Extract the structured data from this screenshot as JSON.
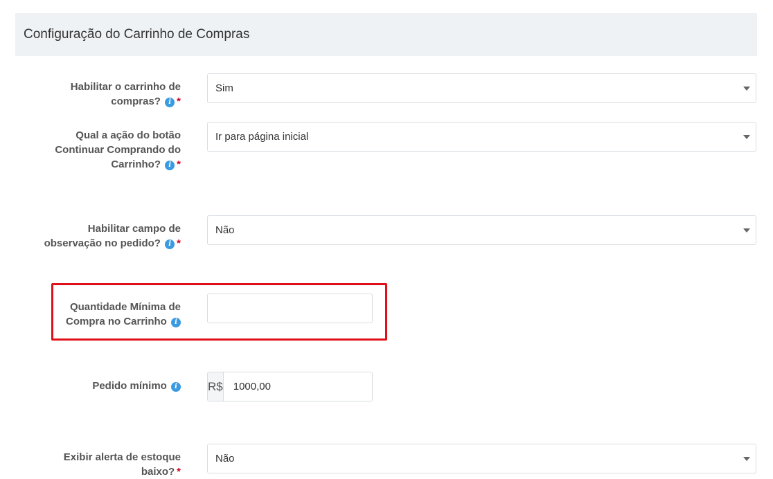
{
  "panel": {
    "title": "Configuração do Carrinho de Compras"
  },
  "fields": {
    "enable_cart": {
      "label_line1": "Habilitar o carrinho de",
      "label_line2": "compras?",
      "value": "Sim"
    },
    "continue_action": {
      "label_line1": "Qual a ação do botão",
      "label_line2": "Continuar Comprando do",
      "label_line3": "Carrinho?",
      "value": "Ir para página inicial"
    },
    "order_note": {
      "label_line1": "Habilitar campo de",
      "label_line2": "observação no pedido?",
      "value": "Não"
    },
    "min_qty": {
      "label_line1": "Quantidade Mínima de",
      "label_line2": "Compra no Carrinho",
      "value": ""
    },
    "min_order": {
      "label": "Pedido mínimo",
      "currency": "R$",
      "value": "1000,00"
    },
    "stock_alert": {
      "label_line1": "Exibir alerta de estoque",
      "label_line2": "baixo?",
      "value": "Não"
    }
  },
  "symbols": {
    "info": "i",
    "required": "*"
  },
  "icons": {
    "info": "info-icon",
    "dropdown": "chevron-down-icon"
  },
  "colors": {
    "highlight": "#e0101a",
    "info": "#3b9be0",
    "required": "#d0021b"
  }
}
